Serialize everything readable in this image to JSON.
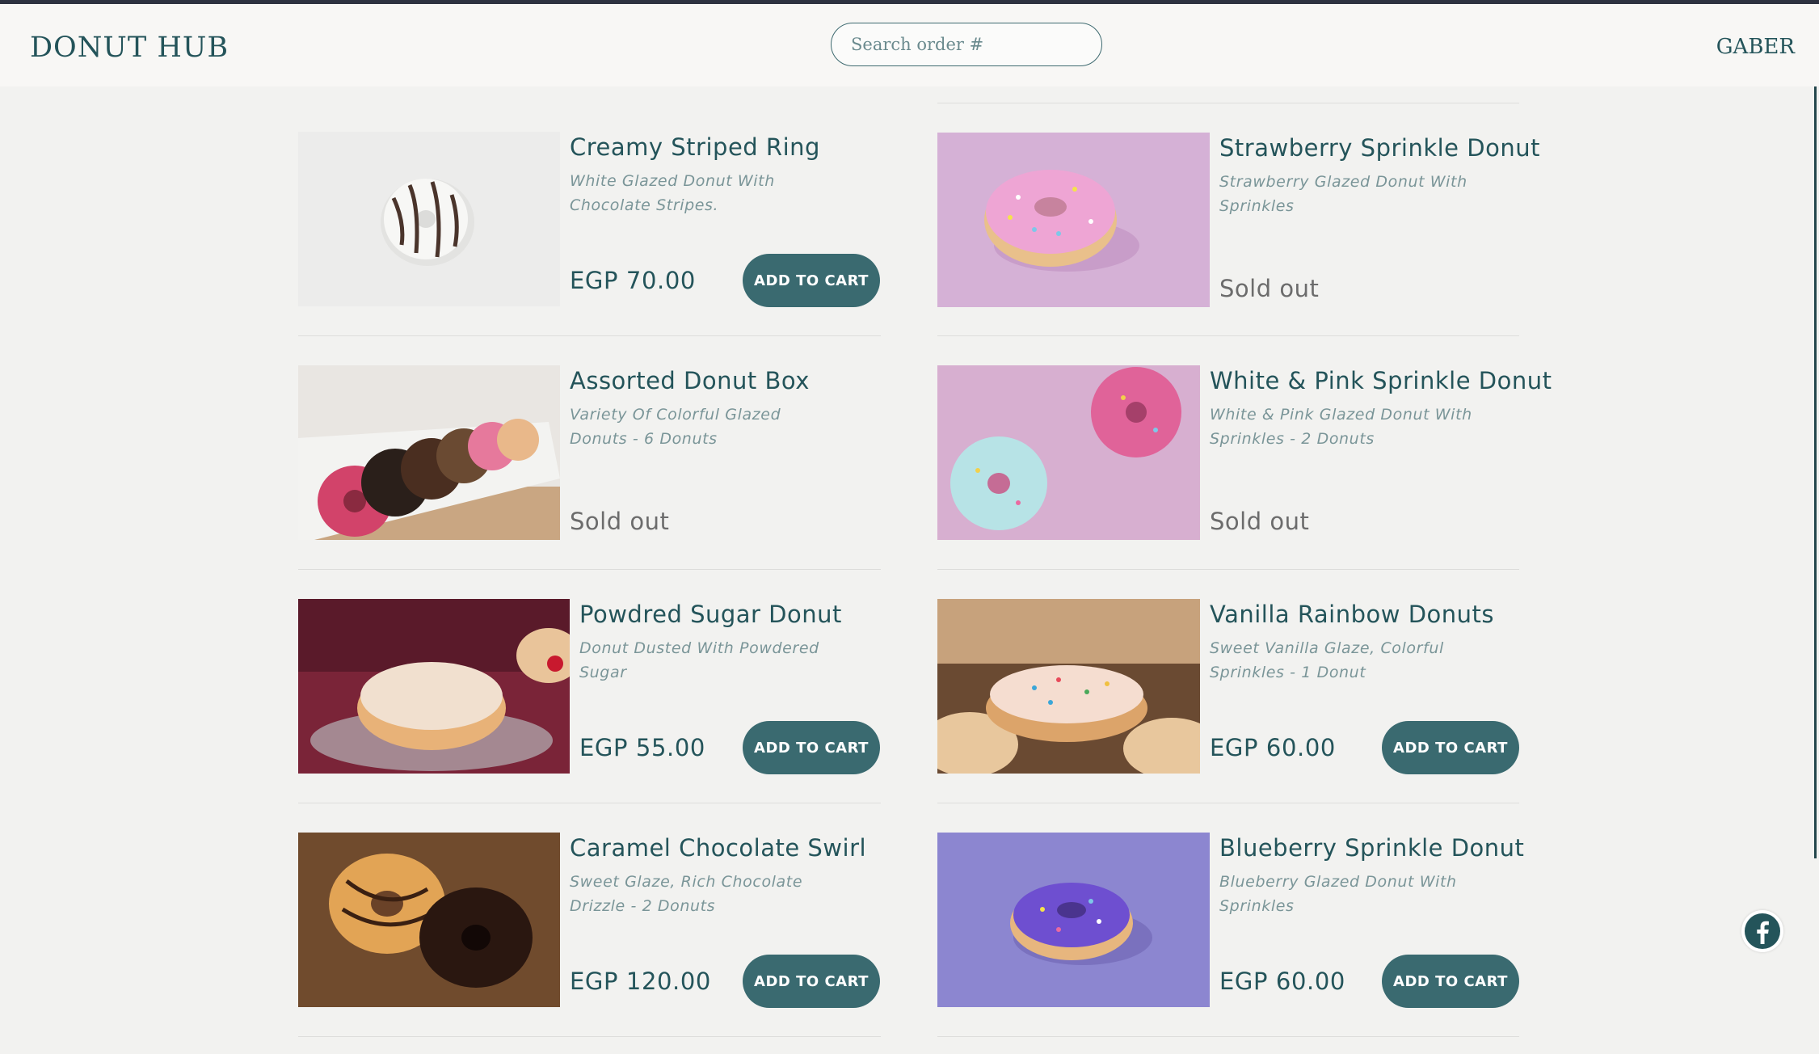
{
  "header": {
    "brand": "DONUT HUB",
    "search_placeholder": "Search order #",
    "user": "GABER"
  },
  "products": [
    {
      "name": "Creamy Striped Ring",
      "desc": "White Glazed Donut With\nChocolate Stripes.",
      "price": "EGP 70.00",
      "status": "",
      "button": "ADD TO CART"
    },
    {
      "name": "Strawberry Sprinkle Donut",
      "desc": "Strawberry Glazed Donut With\nSprinkles",
      "price": "",
      "status": "Sold out",
      "button": ""
    },
    {
      "name": "Assorted Donut Box",
      "desc": "Variety Of Colorful Glazed\nDonuts - 6 Donuts",
      "price": "",
      "status": "Sold out",
      "button": ""
    },
    {
      "name": "White & Pink Sprinkle Donut",
      "desc": "White & Pink Glazed Donut With\nSprinkles - 2 Donuts",
      "price": "",
      "status": "Sold out",
      "button": ""
    },
    {
      "name": "Powdred Sugar Donut",
      "desc": "Donut Dusted With Powdered\nSugar",
      "price": "EGP 55.00",
      "status": "",
      "button": "ADD TO CART"
    },
    {
      "name": "Vanilla Rainbow Donuts",
      "desc": "Sweet Vanilla Glaze, Colorful\nSprinkles - 1 Donut",
      "price": "EGP 60.00",
      "status": "",
      "button": "ADD TO CART"
    },
    {
      "name": "Caramel Chocolate Swirl",
      "desc": "Sweet Glaze, Rich Chocolate\nDrizzle - 2 Donuts",
      "price": "EGP 120.00",
      "status": "",
      "button": "ADD TO CART"
    },
    {
      "name": "Blueberry Sprinkle Donut",
      "desc": "Blueberry Glazed Donut With\nSprinkles",
      "price": "EGP 60.00",
      "status": "",
      "button": "ADD TO CART"
    }
  ],
  "social": {
    "icon": "facebook-icon"
  }
}
